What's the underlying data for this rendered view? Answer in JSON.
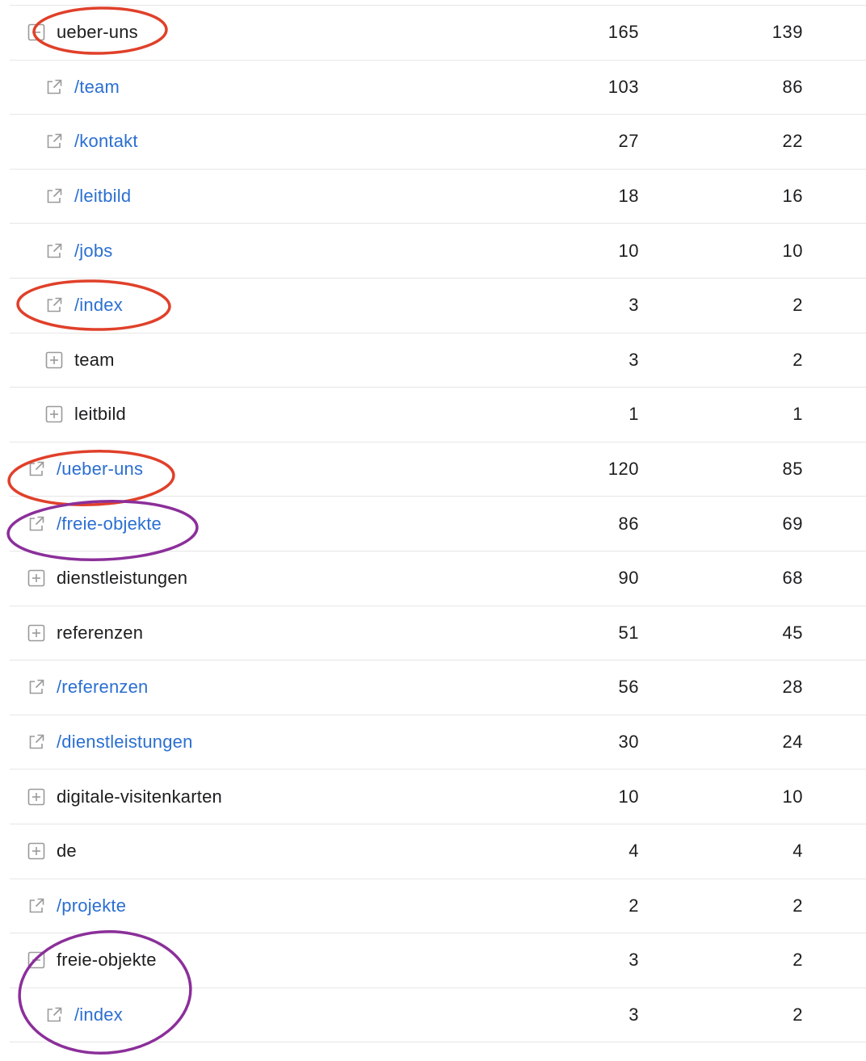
{
  "colors": {
    "link": "#2b6fd1",
    "text": "#1d1d1f",
    "divider": "#e6e6e6",
    "icon": "#9a9a9a",
    "annotation_red": "#e0402a",
    "annotation_purple": "#8b2f9a"
  },
  "rows": [
    {
      "type": "folder",
      "state": "collapse",
      "level": 0,
      "label": "ueber-uns",
      "c1": "165",
      "c2": "139"
    },
    {
      "type": "link",
      "level": 1,
      "label": "/team",
      "c1": "103",
      "c2": "86"
    },
    {
      "type": "link",
      "level": 1,
      "label": "/kontakt",
      "c1": "27",
      "c2": "22"
    },
    {
      "type": "link",
      "level": 1,
      "label": "/leitbild",
      "c1": "18",
      "c2": "16"
    },
    {
      "type": "link",
      "level": 1,
      "label": "/jobs",
      "c1": "10",
      "c2": "10"
    },
    {
      "type": "link",
      "level": 1,
      "label": "/index",
      "c1": "3",
      "c2": "2"
    },
    {
      "type": "folder",
      "state": "expand",
      "level": 1,
      "label": "team",
      "c1": "3",
      "c2": "2"
    },
    {
      "type": "folder",
      "state": "expand",
      "level": 1,
      "label": "leitbild",
      "c1": "1",
      "c2": "1"
    },
    {
      "type": "link",
      "level": 0,
      "label": "/ueber-uns",
      "c1": "120",
      "c2": "85"
    },
    {
      "type": "link",
      "level": 0,
      "label": "/freie-objekte",
      "c1": "86",
      "c2": "69"
    },
    {
      "type": "folder",
      "state": "expand",
      "level": 0,
      "label": "dienstleistungen",
      "c1": "90",
      "c2": "68"
    },
    {
      "type": "folder",
      "state": "expand",
      "level": 0,
      "label": "referenzen",
      "c1": "51",
      "c2": "45"
    },
    {
      "type": "link",
      "level": 0,
      "label": "/referenzen",
      "c1": "56",
      "c2": "28"
    },
    {
      "type": "link",
      "level": 0,
      "label": "/dienstleistungen",
      "c1": "30",
      "c2": "24"
    },
    {
      "type": "folder",
      "state": "expand",
      "level": 0,
      "label": "digitale-visitenkarten",
      "c1": "10",
      "c2": "10"
    },
    {
      "type": "folder",
      "state": "expand",
      "level": 0,
      "label": "de",
      "c1": "4",
      "c2": "4"
    },
    {
      "type": "link",
      "level": 0,
      "label": "/projekte",
      "c1": "2",
      "c2": "2"
    },
    {
      "type": "folder",
      "state": "collapse",
      "level": 0,
      "label": "freie-objekte",
      "c1": "3",
      "c2": "2"
    },
    {
      "type": "link",
      "level": 1,
      "label": "/index",
      "c1": "3",
      "c2": "2"
    }
  ],
  "annotations": [
    {
      "shape": "ellipse",
      "color": "red",
      "target": "ueber-uns"
    },
    {
      "shape": "ellipse",
      "color": "red",
      "target": "/index"
    },
    {
      "shape": "ellipse",
      "color": "red",
      "target": "/ueber-uns"
    },
    {
      "shape": "ellipse",
      "color": "purple",
      "target": "/freie-objekte"
    },
    {
      "shape": "ellipse",
      "color": "purple",
      "target": "freie-objekte /index"
    }
  ]
}
